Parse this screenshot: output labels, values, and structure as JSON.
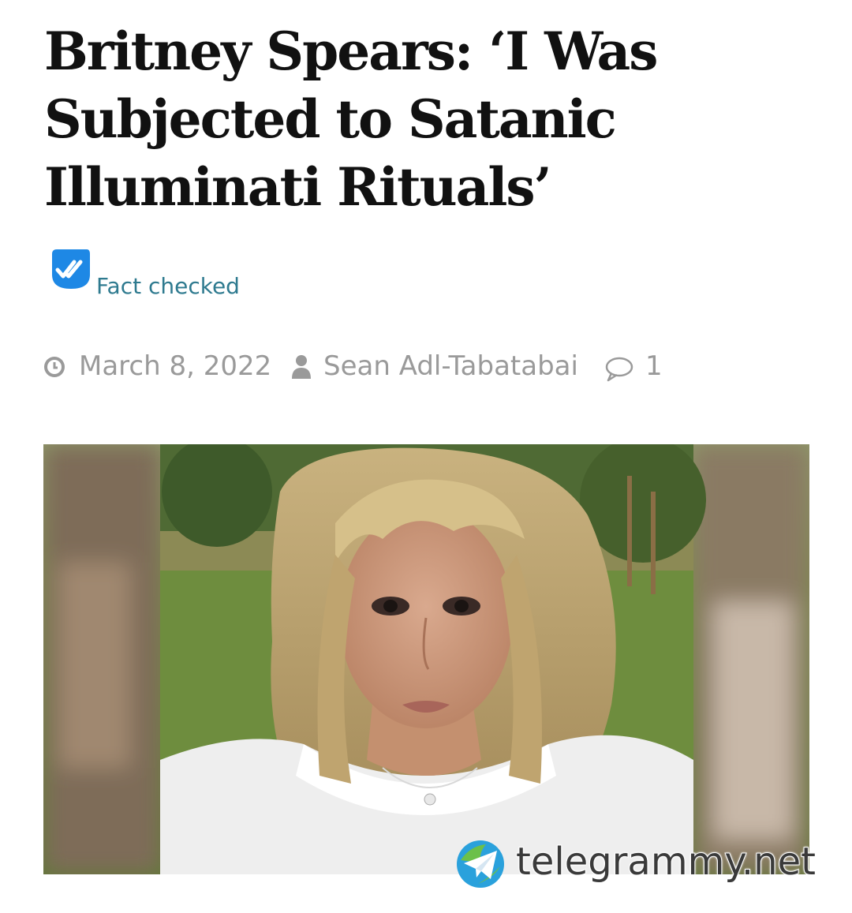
{
  "article": {
    "headline": "Britney Spears: ‘I Was Subjected to Satanic Illuminati Rituals’",
    "fact_check_label": "Fact checked",
    "date": "March 8, 2022",
    "author": "Sean Adl-Tabatabai",
    "comment_count": "1",
    "image_alt": "Britney Spears selfie outdoors"
  },
  "icons": {
    "fact_check": "double-check-badge-icon",
    "date": "clock-icon",
    "author": "user-icon",
    "comments": "speech-bubble-icon"
  },
  "watermark": {
    "text": "telegrammy.net",
    "logo": "globe-paper-plane-logo"
  },
  "colors": {
    "headline": "#111111",
    "fact_check_text": "#2e7a8f",
    "fact_check_badge": "#1e88e5",
    "meta_text": "#9a9a9a"
  }
}
